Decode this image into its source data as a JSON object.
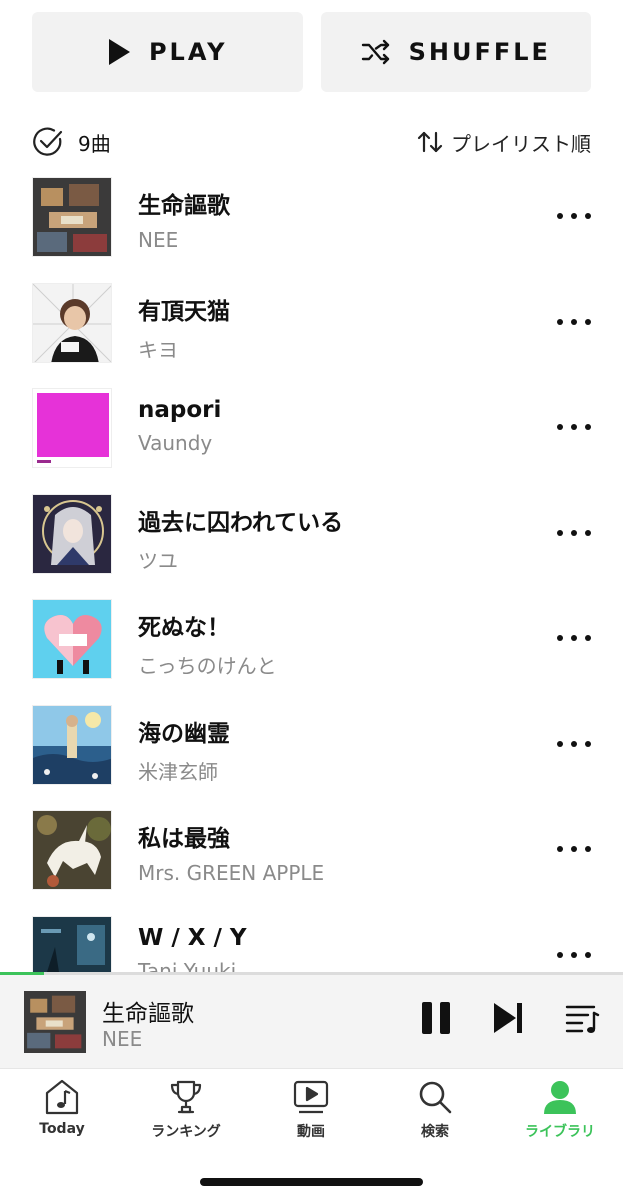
{
  "header_actions": {
    "play_label": "PLAY",
    "shuffle_label": "SHUFFLE"
  },
  "list_meta": {
    "count_label": "9曲",
    "sort_label": "プレイリスト順"
  },
  "tracks": [
    {
      "title": "生命謳歌",
      "artist": "NEE"
    },
    {
      "title": "有頂天猫",
      "artist": "キヨ"
    },
    {
      "title": "napori",
      "artist": "Vaundy"
    },
    {
      "title": "過去に囚われている",
      "artist": "ツユ"
    },
    {
      "title": "死ぬな！",
      "artist": "こっちのけんと"
    },
    {
      "title": "海の幽霊",
      "artist": "米津玄師"
    },
    {
      "title": "私は最強",
      "artist": "Mrs. GREEN APPLE"
    },
    {
      "title": "W / X / Y",
      "artist": "Tani Yuuki"
    }
  ],
  "now_playing": {
    "title": "生命謳歌",
    "artist": "NEE",
    "progress": 0.07
  },
  "tabs": [
    {
      "label": "Today",
      "icon": "music-note-icon"
    },
    {
      "label": "ランキング",
      "icon": "trophy-icon"
    },
    {
      "label": "動画",
      "icon": "video-icon"
    },
    {
      "label": "検索",
      "icon": "search-icon"
    },
    {
      "label": "ライブラリ",
      "icon": "person-icon",
      "active": true
    }
  ],
  "colors": {
    "accent": "#3cc35a",
    "button_bg": "#f2f2f2",
    "secondary_text": "#8a8a8a"
  }
}
